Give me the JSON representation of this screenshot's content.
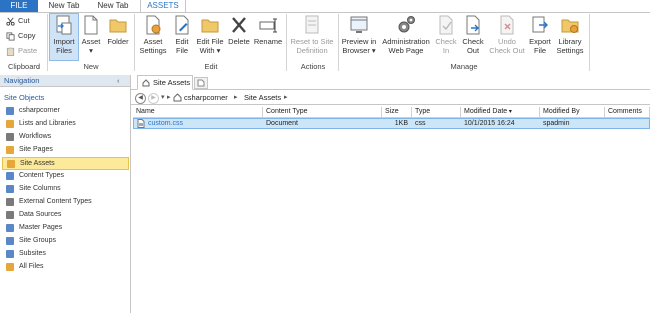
{
  "ribbon_tabs": {
    "file": "FILE",
    "new_tab_1": "New Tab",
    "new_tab_2": "New Tab",
    "assets": "ASSETS"
  },
  "clipboard": {
    "cut": "Cut",
    "copy": "Copy",
    "paste": "Paste",
    "group_label": "Clipboard"
  },
  "new_group": {
    "import_files": [
      "Import",
      "Files"
    ],
    "asset": [
      "Asset",
      "▾"
    ],
    "folder": "Folder",
    "group_label": "New"
  },
  "edit_group": {
    "asset_settings": [
      "Asset",
      "Settings"
    ],
    "edit_file": [
      "Edit",
      "File"
    ],
    "edit_file_with": [
      "Edit File",
      "With ▾"
    ],
    "delete": "Delete",
    "rename": "Rename",
    "group_label": "Edit"
  },
  "actions_group": {
    "reset_to_site_definition": [
      "Reset to Site",
      "Definition"
    ],
    "group_label": "Actions"
  },
  "manage_group": {
    "preview_in_browser": [
      "Preview in",
      "Browser ▾"
    ],
    "administration_web_page": [
      "Administration",
      "Web Page"
    ],
    "check_in": [
      "Check",
      "In"
    ],
    "check_out": [
      "Check",
      "Out"
    ],
    "undo_check_out": [
      "Undo",
      "Check Out"
    ],
    "export_file": [
      "Export",
      "File"
    ],
    "library_settings": [
      "Library",
      "Settings"
    ],
    "group_label": "Manage"
  },
  "navigation": {
    "title": "Navigation",
    "collapse_glyph": "‹",
    "section_title": "Site Objects",
    "items": [
      "csharpcorner",
      "Lists and Libraries",
      "Workflows",
      "Site Pages",
      "Site Assets",
      "Content Types",
      "Site Columns",
      "External Content Types",
      "Data Sources",
      "Master Pages",
      "Site Groups",
      "Subsites",
      "All Files"
    ],
    "selected": "Site Assets"
  },
  "document_tab": {
    "label": "Site Assets"
  },
  "breadcrumb": {
    "site": "csharpcorner",
    "separator": "▸",
    "library": "Site Assets"
  },
  "table": {
    "columns": [
      "Name",
      "Content Type",
      "Size",
      "Type",
      "Modified Date",
      "Modified By",
      "Comments"
    ],
    "sort_glyph": "▾",
    "rows": [
      {
        "name": "custom.css",
        "content_type": "Document",
        "size": "1KB",
        "type": "css",
        "modified_date": "10/1/2015 16:24",
        "modified_by": "spadmin",
        "comments": ""
      }
    ]
  },
  "colors": {
    "accent": "#2b74c5",
    "selected_nav": "#fde99a",
    "selected_row": "#cde6f7"
  }
}
